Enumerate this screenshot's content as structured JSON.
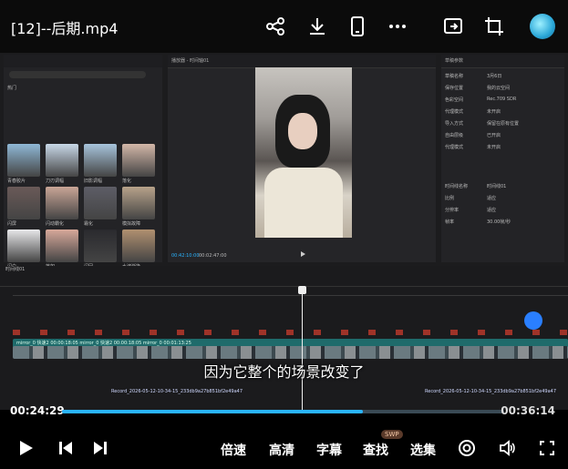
{
  "header": {
    "title": "[12]--后期.mp4"
  },
  "editor": {
    "preview_title": "播放器 - 时间轴01",
    "left_section_label": "热门",
    "left_tabs": [
      "导入",
      "音频",
      "文本",
      "贴纸",
      "特效",
      "转场",
      "滤镜",
      "调节"
    ],
    "thumb_labels": [
      "青春胶片",
      "刀刃调幅",
      "旧影调幅",
      "落化",
      "闪屏",
      "闪动霸化",
      "霜化",
      "模拟故障",
      "闪白",
      "落如",
      "闪回",
      "水波渐换",
      "黄昏暗调",
      "扭化",
      "模糊",
      "水墨渐换"
    ],
    "preview_time": "00:42:10:00",
    "preview_duration": "00:02:47:00",
    "props_title": "草稿参数",
    "props": [
      {
        "k": "草稿名称",
        "v": "3月6日"
      },
      {
        "k": "保存位置",
        "v": "我的云空间"
      },
      {
        "k": "色彩空间",
        "v": "Rec.709 SDR"
      },
      {
        "k": "代理模式",
        "v": "未开启"
      },
      {
        "k": "导入方式",
        "v": "保留在原有位置"
      },
      {
        "k": "自由层级",
        "v": "已开启"
      },
      {
        "k": "代理模式",
        "v": "未开启"
      },
      {
        "k": "时间线名称",
        "v": "时间线01"
      },
      {
        "k": "比例",
        "v": "适应"
      },
      {
        "k": "分辨率",
        "v": "适应"
      },
      {
        "k": "帧率",
        "v": "30.00帧/秒"
      }
    ],
    "timeline_label": "时间线01",
    "audio_clip_1": "Record_2026-05-12-10-34-15_233db9a27b851bf2e49a47",
    "audio_clip_2": "Record_2026-05-12-10-34-15_233db9a27b851bf2e49a47",
    "video_clip_label": "mirror_0 快速2 00:00:18:05  mirror_0 快速2 00:00:18:05  mirror_0 00:01:13:25"
  },
  "subtitle": "因为它整个的场景改变了",
  "player": {
    "current_time": "00:24:29",
    "end_time": "00:36:14",
    "progress": 0.68
  },
  "controls": {
    "speed": "倍速",
    "quality": "高清",
    "captions": "字幕",
    "find": "查找",
    "episodes": "选集",
    "swp_badge": "SWP"
  },
  "colors": {
    "accent": "#2ab4ff",
    "track_teal": "#1f6b6b",
    "track_audio": "#2a3f8f"
  },
  "icons": [
    "share-icon",
    "download-icon",
    "phone-icon",
    "more-icon",
    "cast-icon",
    "crop-icon",
    "avatar-icon",
    "play-icon",
    "prev-icon",
    "next-icon",
    "target-icon",
    "volume-icon",
    "fullscreen-icon"
  ]
}
